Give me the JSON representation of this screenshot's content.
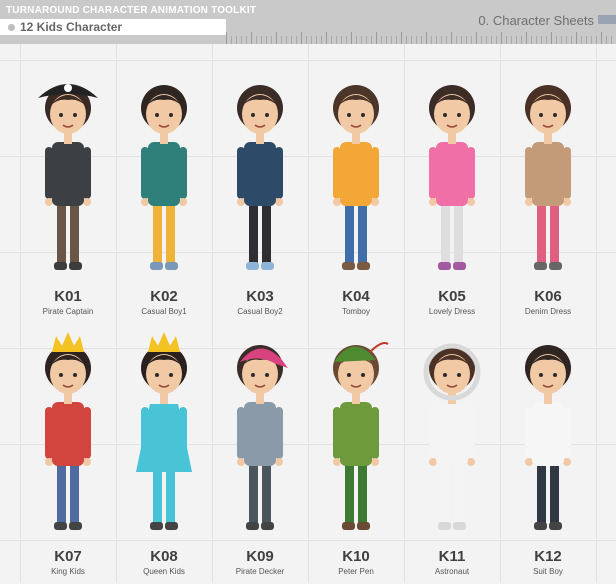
{
  "header": {
    "title": "TURNAROUND CHARACTER ANIMATION TOOLKIT",
    "subtitle": "12 Kids Character",
    "sheet": "0. Character Sheets"
  },
  "characters": [
    {
      "code": "K01",
      "name": "Pirate Captain",
      "skin": "#f2c9a5",
      "hair": "#3a2a24",
      "top": "#3c3f44",
      "bottom": "#6a5646",
      "shoes": "#3c3c3c",
      "hat": "pirate"
    },
    {
      "code": "K02",
      "name": "Casual Boy1",
      "skin": "#f2c9a5",
      "hair": "#2f2622",
      "top": "#2f7f7a",
      "bottom": "#f0b33a",
      "shoes": "#7c98b8",
      "hat": "none"
    },
    {
      "code": "K03",
      "name": "Casual Boy2",
      "skin": "#f2c9a5",
      "hair": "#3a2c26",
      "top": "#2d4b68",
      "bottom": "#2f2f33",
      "shoes": "#8fb6d8",
      "hat": "none"
    },
    {
      "code": "K04",
      "name": "Tomboy",
      "skin": "#f2c9a5",
      "hair": "#4b3428",
      "top": "#f2a737",
      "bottom": "#3f6ea8",
      "shoes": "#7b5a44",
      "hat": "none"
    },
    {
      "code": "K05",
      "name": "Lovely Dress",
      "skin": "#f2c9a5",
      "hair": "#3b2c26",
      "top": "#ef6fa6",
      "bottom": "#dedede",
      "shoes": "#a25aa1",
      "hat": "none"
    },
    {
      "code": "K06",
      "name": "Denim Dress",
      "skin": "#f2c9a5",
      "hair": "#4a3126",
      "top": "#c49b78",
      "bottom": "#e05f80",
      "shoes": "#666",
      "hat": "none"
    },
    {
      "code": "K07",
      "name": "King Kids",
      "skin": "#f2c9a5",
      "hair": "#2d2320",
      "top": "#d2443e",
      "bottom": "#4f6b9f",
      "shoes": "#444",
      "hat": "crown"
    },
    {
      "code": "K08",
      "name": "Queen Kids",
      "skin": "#f2c9a5",
      "hair": "#2a201d",
      "top": "#48c4d6",
      "bottom": "#48c4d6",
      "shoes": "#444",
      "hat": "crown"
    },
    {
      "code": "K09",
      "name": "Pirate Decker",
      "skin": "#f2c9a5",
      "hair": "#3a2c26",
      "top": "#8a9aa8",
      "bottom": "#4c565f",
      "shoes": "#444",
      "hat": "bandana"
    },
    {
      "code": "K10",
      "name": "Peter Pen",
      "skin": "#f2c9a5",
      "hair": "#6b4a35",
      "top": "#6f9a3c",
      "bottom": "#3f7a35",
      "shoes": "#6a4a34",
      "hat": "feather"
    },
    {
      "code": "K11",
      "name": "Astronaut",
      "skin": "#f2c9a5",
      "hair": "#4b3126",
      "top": "#f4f4f4",
      "bottom": "#f4f4f4",
      "shoes": "#d8d8d8",
      "hat": "helmet"
    },
    {
      "code": "K12",
      "name": "Suit Boy",
      "skin": "#f2c9a5",
      "hair": "#2f2622",
      "top": "#f6f6f6",
      "bottom": "#303844",
      "shoes": "#444",
      "hat": "none"
    }
  ]
}
